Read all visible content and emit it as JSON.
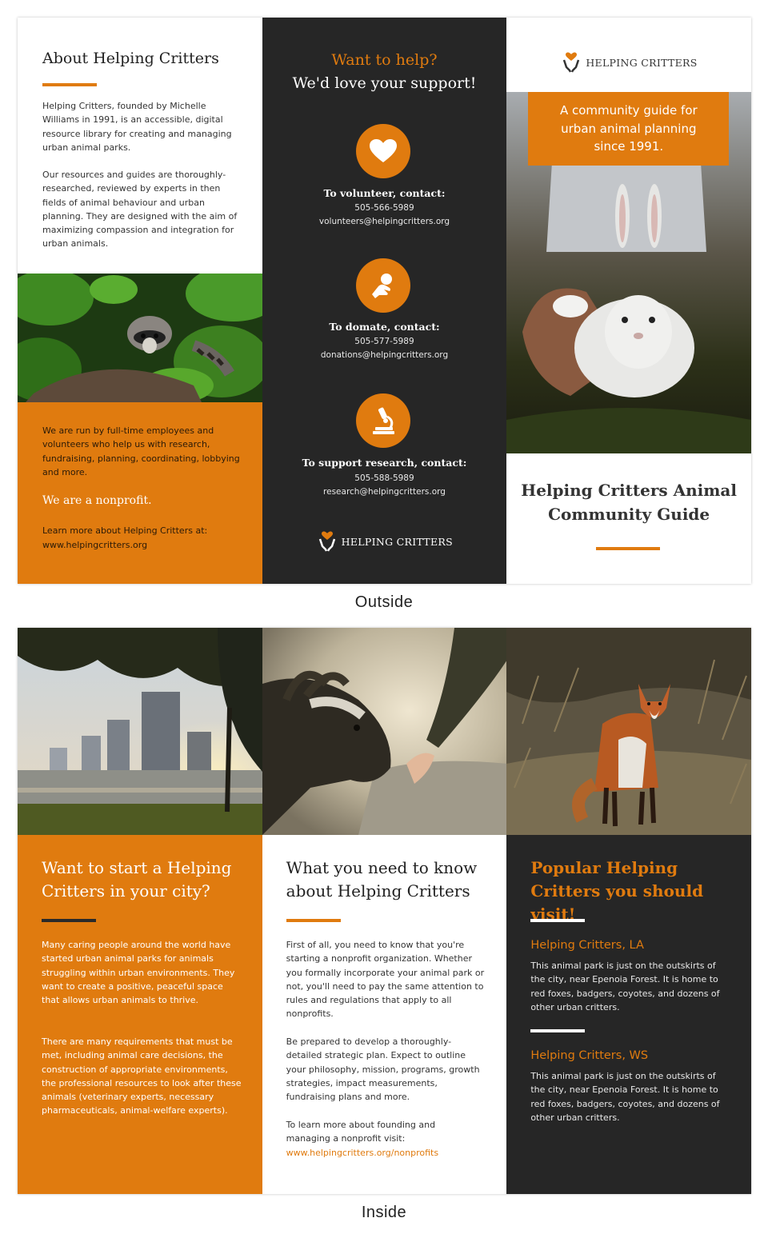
{
  "outside": {
    "caption": "Outside",
    "about": {
      "title": "About Helping Critters",
      "paragraph1": "Helping Critters, founded by Michelle Williams in 1991, is an accessible, digital resource library for creating and managing urban animal parks.",
      "paragraph2": "Our resources and guides are thoroughly-researched, reviewed by experts in then fields of animal behaviour and urban planning. They are designed with the aim of maximizing compassion and integration for urban animals.",
      "photo": "raccoon-photo",
      "staff_text": "We are run by full-time employees and volunteers who help us with research, fundraising, planning, coordinating, lobbying and more.",
      "nonprofit": "We are a nonprofit.",
      "learn_more": "Learn more about Helping Critters at:",
      "website": "www.helpingcritters.org"
    },
    "help": {
      "title_line1": "Want to help?",
      "title_line2": "We'd love your support!",
      "contacts": [
        {
          "icon": "heart-icon",
          "heading": "To volunteer, contact:",
          "phone": "505-566-5989",
          "email": "volunteers@helpingcritters.org"
        },
        {
          "icon": "donate-hand-icon",
          "heading": "To domate, contact:",
          "phone": "505-577-5989",
          "email": "donations@helpingcritters.org"
        },
        {
          "icon": "microscope-icon",
          "heading": "To support research, contact:",
          "phone": "505-588-5989",
          "email": "research@helpingcritters.org"
        }
      ],
      "logo_text": "HELPING CRITTERS"
    },
    "cover": {
      "logo_text": "HELPING CRITTERS",
      "tagline": "A community guide for urban animal planning since 1991.",
      "photo": "rabbit-photo",
      "title_line1": "Helping Critters Animal",
      "title_line2": "Community Guide"
    }
  },
  "inside": {
    "caption": "Inside",
    "start": {
      "photo": "city-park-photo",
      "title": "Want to start a Helping Critters in your city?",
      "paragraph1": "Many caring people around the world have started urban animal parks for animals struggling within urban environments. They want to create a positive, peaceful space that allows urban animals to thrive.",
      "paragraph2": "There are many requirements that must be met, including animal care decisions, the construction of appropriate environments, the professional resources to look after these animals (veterinary experts, necessary pharmaceuticals, animal-welfare experts)."
    },
    "know": {
      "photo": "goat-photo",
      "title": "What you need to know about Helping Critters",
      "paragraph1": "First of all, you need to know that you're starting a nonprofit organization. Whether you formally incorporate your animal park or not, you'll need to pay the same attention to rules and regulations that apply to all nonprofits.",
      "paragraph2": "Be prepared to develop a thoroughly-detailed strategic plan. Expect to outline your philosophy, mission, programs, growth strategies, impact measurements, fundraising plans and more.",
      "paragraph3": "To learn more about founding and managing a nonprofit visit:",
      "link": "www.helpingcritters.org/nonprofits"
    },
    "popular": {
      "photo": "fox-photo",
      "title": "Popular Helping Critters you should visit!",
      "parks": [
        {
          "name": "Helping Critters, LA",
          "description": "This animal park is just on the outskirts of the city, near Epenoia Forest. It is home to red foxes, badgers, coyotes, and dozens of other urban critters."
        },
        {
          "name": "Helping Critters, WS",
          "description": "This animal park is just on the outskirts of the city, near Epenoia Forest. It is home to red foxes, badgers, coyotes, and dozens of other urban critters."
        }
      ]
    }
  },
  "colors": {
    "accent": "#e07b0f",
    "dark": "#262626",
    "white": "#ffffff"
  }
}
